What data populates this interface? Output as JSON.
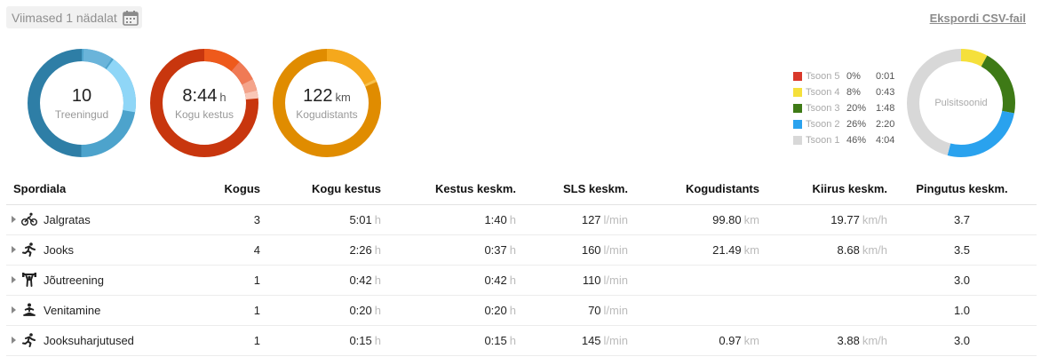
{
  "header": {
    "period_label": "Viimased 1 nädalat",
    "export_label": "Ekspordi CSV-fail"
  },
  "summary": {
    "workouts": {
      "value": "10",
      "unit": "",
      "label": "Treeningud"
    },
    "duration": {
      "value": "8:44",
      "unit": "h",
      "label": "Kogu kestus"
    },
    "distance": {
      "value": "122",
      "unit": "km",
      "label": "Kogudistants"
    }
  },
  "zones": {
    "label": "Pulsitsoonid",
    "items": [
      {
        "name": "Tsoon 5",
        "percent": "0%",
        "time": "0:01",
        "fraction": 0.0,
        "color": "#d9382a"
      },
      {
        "name": "Tsoon 4",
        "percent": "8%",
        "time": "0:43",
        "fraction": 0.08,
        "color": "#f5e03b"
      },
      {
        "name": "Tsoon 3",
        "percent": "20%",
        "time": "1:48",
        "fraction": 0.2,
        "color": "#3e7a16"
      },
      {
        "name": "Tsoon 2",
        "percent": "26%",
        "time": "2:20",
        "fraction": 0.26,
        "color": "#2aa2ee"
      },
      {
        "name": "Tsoon 1",
        "percent": "46%",
        "time": "4:04",
        "fraction": 0.46,
        "color": "#d8d8d8"
      }
    ]
  },
  "table": {
    "headers": {
      "sport": "Spordiala",
      "count": "Kogus",
      "total_duration": "Kogu kestus",
      "avg_duration": "Kestus keskm.",
      "avg_hr": "SLS keskm.",
      "distance": "Kogudistants",
      "avg_speed": "Kiirus keskm.",
      "avg_effort": "Pingutus keskm."
    },
    "units": {
      "duration": "h",
      "hr": "l/min",
      "distance": "km",
      "speed": "km/h"
    },
    "rows": [
      {
        "icon": "cycling-icon",
        "sport": "Jalgratas",
        "count": "3",
        "total_duration": "5:01",
        "avg_duration": "1:40",
        "avg_hr": "127",
        "distance": "99.80",
        "avg_speed": "19.77",
        "avg_effort": "3.7"
      },
      {
        "icon": "running-icon",
        "sport": "Jooks",
        "count": "4",
        "total_duration": "2:26",
        "avg_duration": "0:37",
        "avg_hr": "160",
        "distance": "21.49",
        "avg_speed": "8.68",
        "avg_effort": "3.5"
      },
      {
        "icon": "weightlifting-icon",
        "sport": "Jõutreening",
        "count": "1",
        "total_duration": "0:42",
        "avg_duration": "0:42",
        "avg_hr": "110",
        "distance": "",
        "avg_speed": "",
        "avg_effort": "3.0"
      },
      {
        "icon": "stretching-icon",
        "sport": "Venitamine",
        "count": "1",
        "total_duration": "0:20",
        "avg_duration": "0:20",
        "avg_hr": "70",
        "distance": "",
        "avg_speed": "",
        "avg_effort": "1.0"
      },
      {
        "icon": "running-drills-icon",
        "sport": "Jooksuharjutused",
        "count": "1",
        "total_duration": "0:15",
        "avg_duration": "0:15",
        "avg_hr": "145",
        "distance": "0.97",
        "avg_speed": "3.88",
        "avg_effort": "3.0"
      }
    ]
  }
}
